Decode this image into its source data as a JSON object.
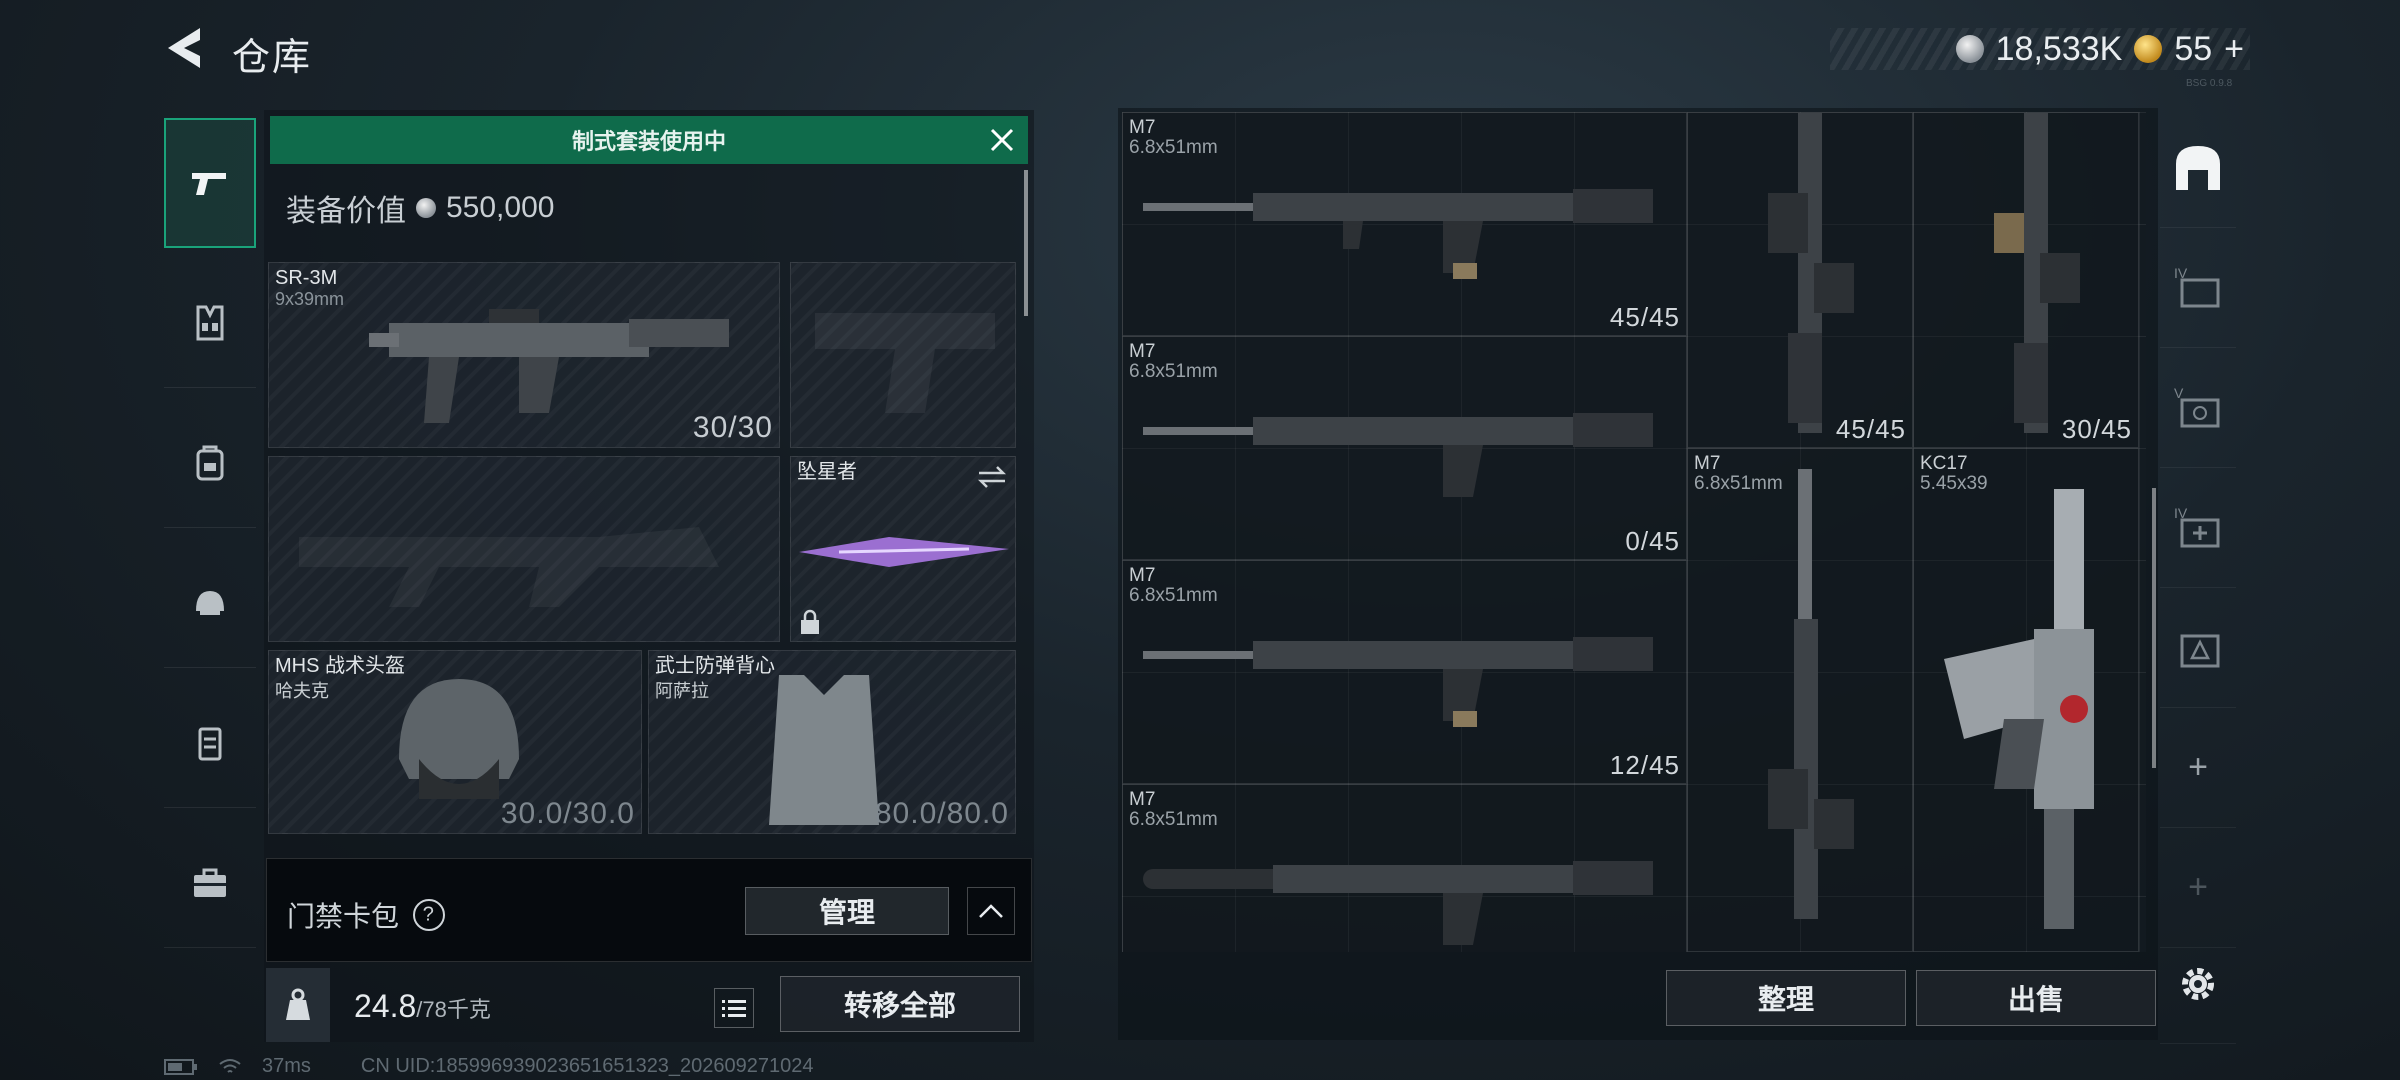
{
  "header": {
    "title": "仓库",
    "silver_amount": "18,533K",
    "gold_amount": "55",
    "gold_plus": "+",
    "version": "BSG 0.9.8"
  },
  "loadout": {
    "banner_text": "制式套装使用中",
    "value_label": "装备价值",
    "value": "550,000",
    "primary": {
      "name": "SR-3M",
      "caliber": "9x39mm",
      "ammo": "30/30"
    },
    "melee": {
      "name": "坠星者"
    },
    "helmet": {
      "name": "MHS 战术头盔",
      "brand": "哈夫克",
      "durability": "30.0/30.0"
    },
    "armor": {
      "name": "武士防弹背心",
      "brand": "阿萨拉",
      "durability": "80.0/80.0"
    },
    "keycard_label": "门禁卡包",
    "keycard_help": "?",
    "manage_label": "管理",
    "weight": "24.8",
    "weight_max": "/78千克",
    "transfer_all_label": "转移全部"
  },
  "storage": {
    "items": [
      {
        "name": "M7",
        "caliber": "6.8x51mm",
        "ammo": "45/45"
      },
      {
        "name": "",
        "caliber": "",
        "ammo": "45/45"
      },
      {
        "name": "",
        "caliber": "",
        "ammo": "30/45"
      },
      {
        "name": "M7",
        "caliber": "6.8x51mm",
        "ammo": "0/45"
      },
      {
        "name": "M7",
        "caliber": "6.8x51mm",
        "ammo": ""
      },
      {
        "name": "KC17",
        "caliber": "5.45x39",
        "ammo": ""
      },
      {
        "name": "M7",
        "caliber": "6.8x51mm",
        "ammo": "12/45"
      },
      {
        "name": "M7",
        "caliber": "6.8x51mm",
        "ammo": ""
      }
    ],
    "sort_label": "整理",
    "sell_label": "出售"
  },
  "right_rail": {
    "tab_labels": [
      "IV",
      "V",
      "IV",
      ""
    ],
    "add_symbol": "+"
  },
  "status": {
    "ping": "37ms",
    "uid": "CN UID:185996939023651651323_202609271024"
  },
  "colors": {
    "accent_green": "#0f6b4b",
    "active_rail": "#1aa37a"
  }
}
